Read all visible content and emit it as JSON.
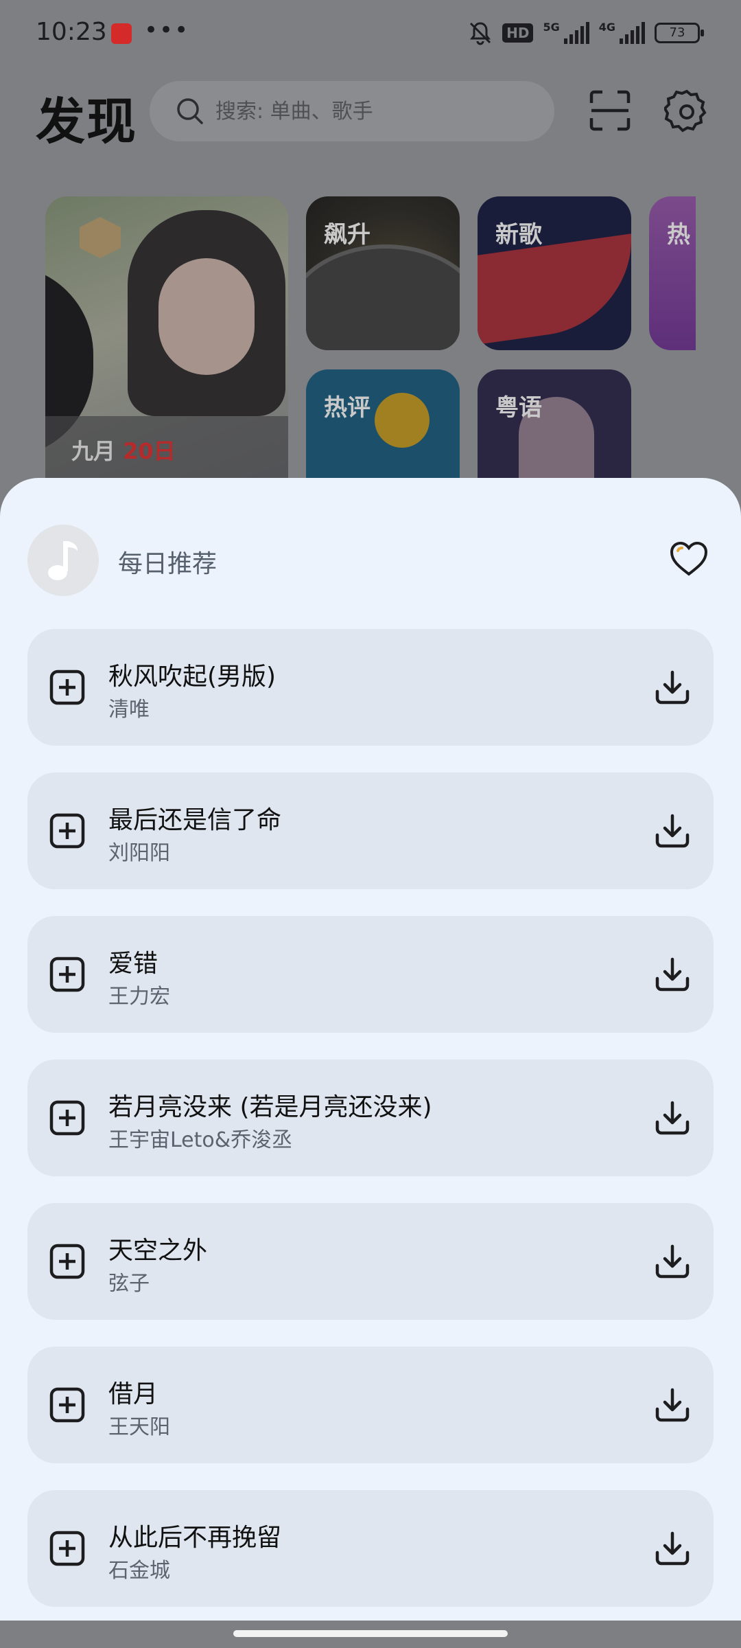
{
  "status_bar": {
    "time": "10:23",
    "dots": "•••",
    "hd": "HD",
    "net_5g": "5G",
    "net_4g": "4G",
    "battery": "73"
  },
  "header": {
    "title": "发现",
    "search_placeholder": "搜索: 单曲、歌手",
    "icons": [
      "scan-icon",
      "settings-icon"
    ]
  },
  "cards": {
    "date_month": "九月",
    "date_day": "20日",
    "items": [
      {
        "label": "飙升"
      },
      {
        "label": "新歌"
      },
      {
        "label": "热"
      },
      {
        "label": "热评"
      },
      {
        "label": "粤语"
      }
    ]
  },
  "sheet": {
    "title": "每日推荐",
    "songs": [
      {
        "name": "秋风吹起(男版)",
        "artist": "清唯"
      },
      {
        "name": "最后还是信了命",
        "artist": "刘阳阳"
      },
      {
        "name": "爱错",
        "artist": "王力宏"
      },
      {
        "name": "若月亮没来 (若是月亮还没来)",
        "artist": "王宇宙Leto&乔浚丞"
      },
      {
        "name": "天空之外",
        "artist": "弦子"
      },
      {
        "name": "借月",
        "artist": "王天阳"
      },
      {
        "name": "从此后不再挽留",
        "artist": "石金城"
      }
    ]
  },
  "colors": {
    "sheet_bg": "#ecf3fc",
    "row_bg": "#dfe6ef",
    "scrim": "#7d7f83"
  }
}
